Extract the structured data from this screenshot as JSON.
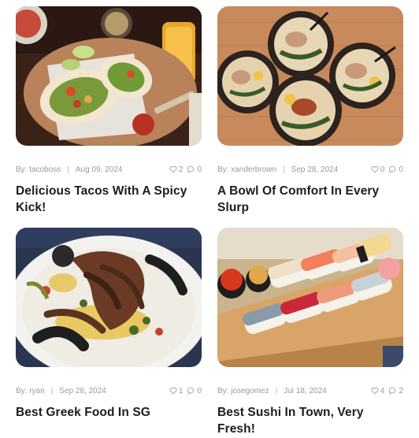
{
  "posts": [
    {
      "image_alt": "Tacos with cilantro and lime on a wooden board",
      "author": "By: tacoboss",
      "date": "Aug 09, 2024",
      "likes": "2",
      "comments": "0",
      "title": "Delicious Tacos With A Spicy Kick!"
    },
    {
      "image_alt": "Bowls of ramen on a wooden table",
      "author": "By: xanderbrown",
      "date": "Sep 28, 2024",
      "likes": "0",
      "comments": "0",
      "title": "A Bowl Of Comfort In Every Slurp"
    },
    {
      "image_alt": "Grilled octopus on a white plate",
      "author": "By: ryan",
      "date": "Sep 28, 2024",
      "likes": "1",
      "comments": "0",
      "title": "Best Greek Food In SG"
    },
    {
      "image_alt": "Assorted sushi on a wooden board",
      "author": "By: josegomez",
      "date": "Jul 18, 2024",
      "likes": "4",
      "comments": "2",
      "title": "Best Sushi In Town, Very Fresh!"
    }
  ],
  "meta": {
    "separator": "|"
  },
  "colors": {
    "meta_text": "#9a9a9a",
    "title_text": "#1c1c1c"
  }
}
